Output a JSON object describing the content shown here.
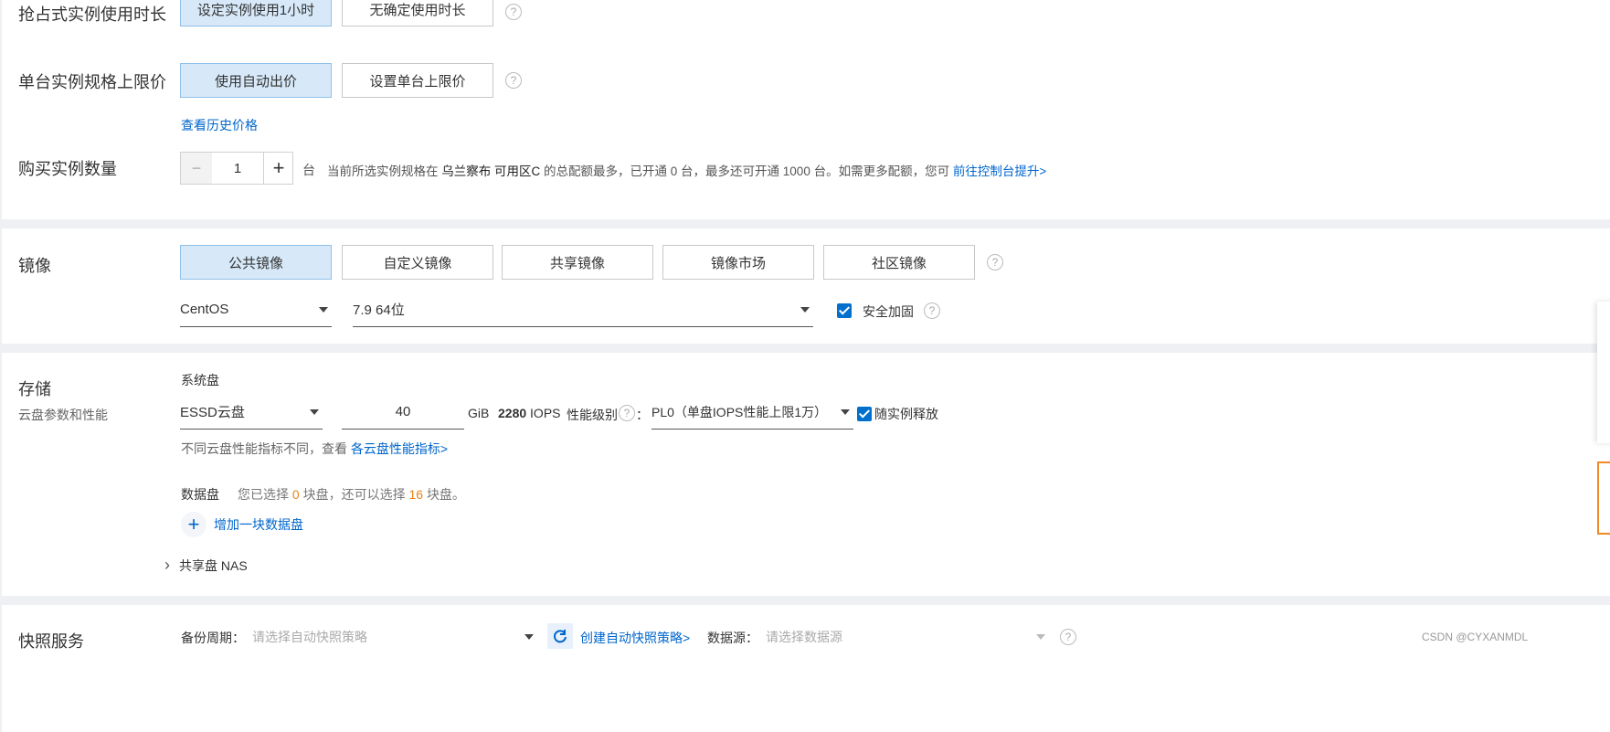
{
  "spot": {
    "duration_label": "抢占式实例使用时长",
    "duration_options": [
      "设定实例使用1小时",
      "无确定使用时长"
    ],
    "price_limit_label": "单台实例规格上限价",
    "price_options": [
      "使用自动出价",
      "设置单台上限价"
    ],
    "history_link": "查看历史价格",
    "help": "?"
  },
  "quantity": {
    "label": "购买实例数量",
    "minus": "−",
    "value": "1",
    "plus": "+",
    "unit": "台",
    "note_pre": "当前所选实例规格在",
    "note_region": "乌兰察布 可用区C",
    "note_post": "的总配额最多，已开通 0 台，最多还可开通 1000 台。如需更多配额，您可",
    "note_link": "前往控制台提升>"
  },
  "image": {
    "label": "镜像",
    "tabs": [
      "公共镜像",
      "自定义镜像",
      "共享镜像",
      "镜像市场",
      "社区镜像"
    ],
    "os": "CentOS",
    "version": "7.9 64位",
    "security_label": "安全加固"
  },
  "storage": {
    "label": "存储",
    "sublabel": "云盘参数和性能",
    "system_disk": "系统盘",
    "disk_type": "ESSD云盘",
    "size": "40",
    "size_unit": "GiB",
    "iops": "2280",
    "iops_unit": "IOPS",
    "perf_label": "性能级别",
    "perf_colon": "：",
    "perf_value": "PL0（单盘IOPS性能上限1万）",
    "release_label": "随实例释放",
    "perf_note": "不同云盘性能指标不同，查看",
    "perf_note_link": "各云盘性能指标>",
    "data_disk": "数据盘",
    "data_note_a": "您已选择",
    "data_selected": "0",
    "data_note_b": "块盘，还可以选择",
    "data_remaining": "16",
    "data_note_c": "块盘。",
    "add_icon": "+",
    "add_disk": "增加一块数据盘",
    "nas_chevron": "›",
    "nas": "共享盘 NAS"
  },
  "snapshot": {
    "label": "快照服务",
    "backup_label": "备份周期：",
    "backup_placeholder": "请选择自动快照策略",
    "create_link": "创建自动快照策略>",
    "source_label": "数据源：",
    "source_placeholder": "请选择数据源"
  },
  "watermark": "CSDN @CYXANMDL"
}
